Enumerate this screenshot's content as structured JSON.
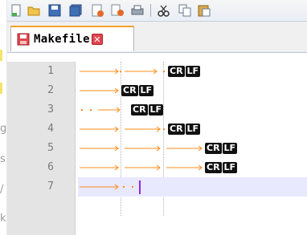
{
  "colors": {
    "whitespace_arrow": "#ff8c1a",
    "current_line": "#e8e8ff",
    "gutter": "#e4e4e4",
    "tab_accent": "#f6a02a",
    "caret": "#8a2be2"
  },
  "toolbar": {
    "icons": [
      "new-file-icon",
      "open-folder-icon",
      "save-icon",
      "save-all-icon",
      "close-icon",
      "close-all-icon",
      "print-icon",
      "cut-icon",
      "copy-icon",
      "paste-icon"
    ]
  },
  "tab": {
    "label": "Makefile",
    "close_glyph": "✕"
  },
  "left_strip": {
    "chars": [
      "g",
      "s",
      "/",
      "k"
    ]
  },
  "editor": {
    "lines": [
      {
        "number": "1",
        "eol": [
          "CR",
          "LF"
        ]
      },
      {
        "number": "2",
        "eol": [
          "CR",
          "LF"
        ]
      },
      {
        "number": "3",
        "eol": [
          "CR",
          "LF"
        ]
      },
      {
        "number": "4",
        "eol": [
          "CR",
          "LF"
        ]
      },
      {
        "number": "5",
        "eol": [
          "CR",
          "LF"
        ]
      },
      {
        "number": "6",
        "eol": [
          "CR",
          "LF"
        ]
      },
      {
        "number": "7",
        "eol": []
      }
    ],
    "current_line": "7"
  }
}
